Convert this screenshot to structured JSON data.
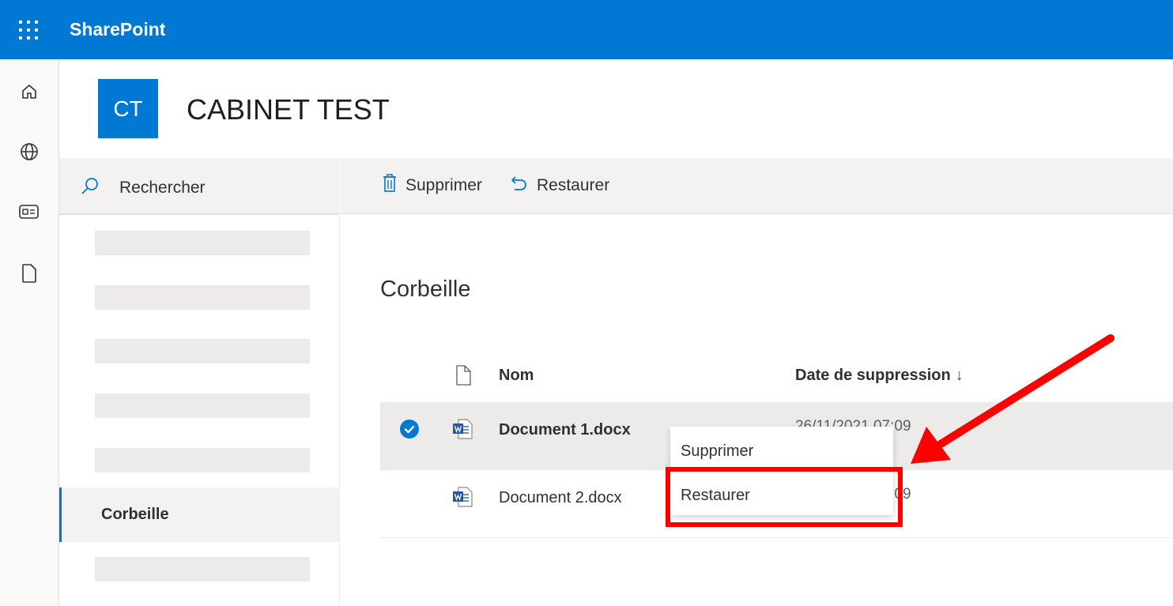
{
  "suite_bar": {
    "app_name": "SharePoint",
    "waffle_icon": "app-launcher-icon"
  },
  "rail": {
    "items": [
      {
        "icon": "home-icon"
      },
      {
        "icon": "globe-icon"
      },
      {
        "icon": "news-icon"
      },
      {
        "icon": "document-icon"
      }
    ]
  },
  "site": {
    "logo_initials": "CT",
    "title": "CABINET TEST",
    "logo_color": "#0078d4"
  },
  "left_nav": {
    "search_label": "Rechercher",
    "active_item": "Corbeille"
  },
  "command_bar": {
    "delete_label": "Supprimer",
    "restore_label": "Restaurer"
  },
  "main": {
    "heading": "Corbeille",
    "columns": {
      "name": "Nom",
      "date": "Date de suppression",
      "sort_indicator": "↓"
    },
    "rows": [
      {
        "name": "Document 1.docx",
        "date": "26/11/2021 07:09",
        "selected": true
      },
      {
        "name": "Document 2.docx",
        "date": "26/11/2021 07:09",
        "selected": false
      }
    ]
  },
  "context_menu": {
    "items": [
      "Supprimer",
      "Restaurer"
    ]
  },
  "colors": {
    "accent": "#0078d4",
    "annotation": "#ff0000"
  }
}
